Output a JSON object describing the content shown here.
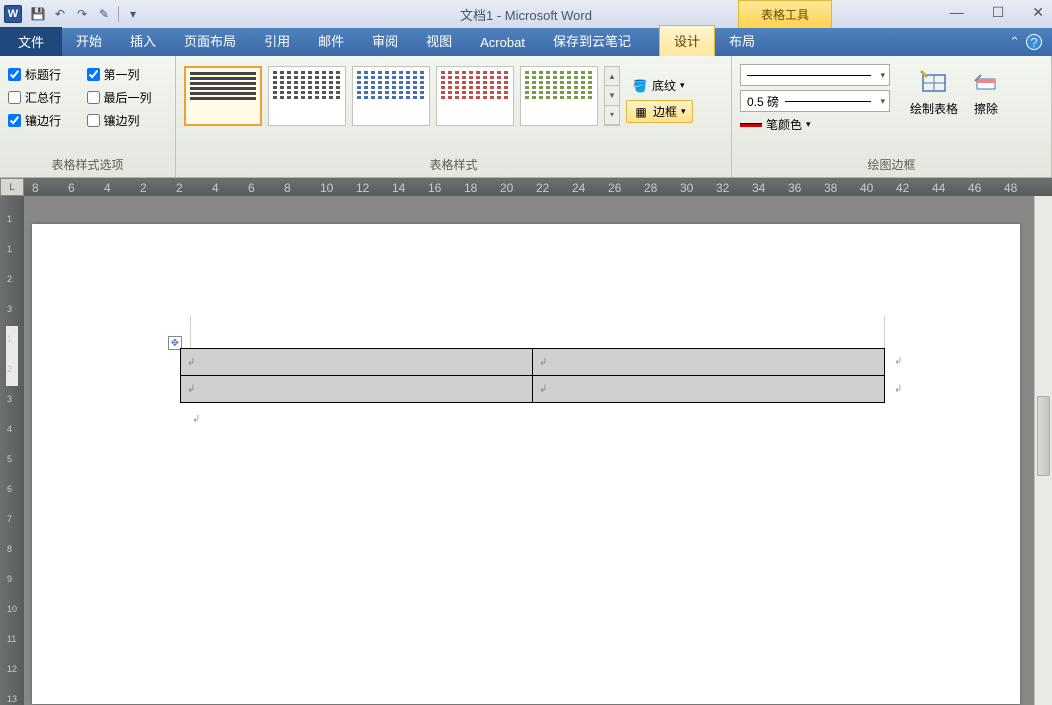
{
  "titlebar": {
    "title": "文档1 - Microsoft Word",
    "context_label": "表格工具"
  },
  "tabs": {
    "file": "文件",
    "home": "开始",
    "insert": "插入",
    "layout": "页面布局",
    "ref": "引用",
    "mail": "邮件",
    "review": "审阅",
    "view": "视图",
    "acrobat": "Acrobat",
    "cloud": "保存到云笔记",
    "design": "设计",
    "tlayout": "布局"
  },
  "options": {
    "header_row": "标题行",
    "first_col": "第一列",
    "total_row": "汇总行",
    "last_col": "最后一列",
    "banded_row": "镶边行",
    "banded_col": "镶边列",
    "group_label": "表格样式选项"
  },
  "styles": {
    "group_label": "表格样式",
    "shading": "底纹",
    "borders": "边框"
  },
  "draw": {
    "weight": "0.5 磅",
    "pen_color": "笔颜色",
    "draw_table": "绘制表格",
    "eraser": "擦除",
    "group_label": "绘图边框"
  },
  "ruler_h": [
    "8",
    "6",
    "4",
    "2",
    "2",
    "4",
    "6",
    "8",
    "10",
    "12",
    "14",
    "16",
    "18",
    "20",
    "22",
    "24",
    "26",
    "28",
    "30",
    "32",
    "34",
    "36",
    "38",
    "40",
    "42",
    "44",
    "46",
    "48"
  ],
  "ruler_v": [
    "1",
    "1",
    "2",
    "3",
    "1",
    "2",
    "3",
    "4",
    "5",
    "6",
    "7",
    "8",
    "9",
    "10",
    "11",
    "12",
    "13"
  ]
}
